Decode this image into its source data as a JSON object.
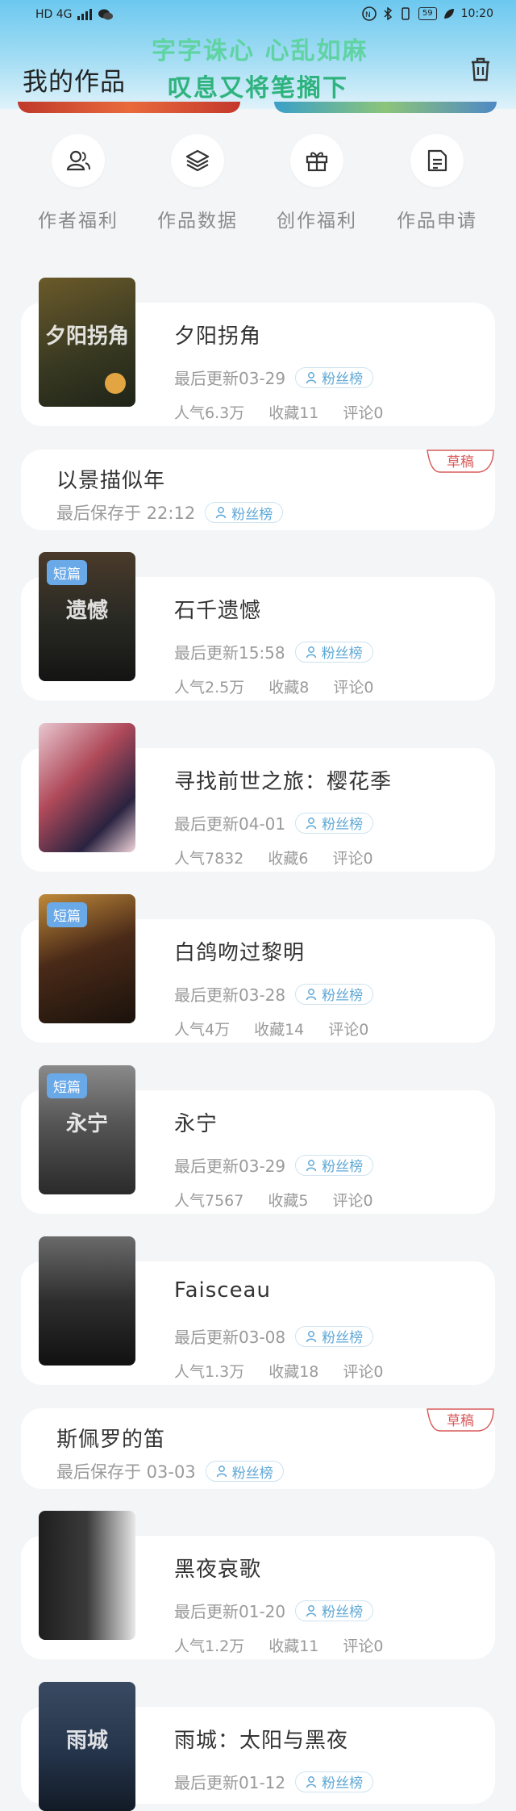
{
  "status_bar": {
    "network": "HD 4G",
    "battery": "59",
    "time": "10:20"
  },
  "header": {
    "title": "我的作品",
    "banner_line1": "字字诛心 心乱如麻",
    "banner_line2": "叹息又将笔搁下",
    "trash_icon": "trash-icon"
  },
  "quick_actions": [
    {
      "label": "作者福利",
      "icon": "user-group-icon"
    },
    {
      "label": "作品数据",
      "icon": "layers-icon"
    },
    {
      "label": "创作福利",
      "icon": "gift-icon"
    },
    {
      "label": "作品申请",
      "icon": "document-icon"
    }
  ],
  "works": [
    {
      "title": "夕阳拐角",
      "updated": "最后更新03-29",
      "badge": "粉丝榜",
      "popularity": "人气6.3万",
      "favorites": "收藏11",
      "comments": "评论0",
      "cover_color": "#3a3a22",
      "cover_text": "夕阳拐角",
      "tag": ""
    },
    {
      "title": "石千遗憾",
      "updated": "最后更新15:58",
      "badge": "粉丝榜",
      "popularity": "人气2.5万",
      "favorites": "收藏8",
      "comments": "评论0",
      "cover_color": "#2a2a24",
      "cover_text": "遗憾",
      "tag": "短篇"
    },
    {
      "title": "寻找前世之旅：樱花季",
      "updated": "最后更新04-01",
      "badge": "粉丝榜",
      "popularity": "人气7832",
      "favorites": "收藏6",
      "comments": "评论0",
      "cover_color": "#b04a5a",
      "cover_text": "",
      "tag": ""
    },
    {
      "title": "白鸽吻过黎明",
      "updated": "最后更新03-28",
      "badge": "粉丝榜",
      "popularity": "人气4万",
      "favorites": "收藏14",
      "comments": "评论0",
      "cover_color": "#4a2a18",
      "cover_text": "",
      "tag": "短篇"
    },
    {
      "title": "永宁",
      "updated": "最后更新03-29",
      "badge": "粉丝榜",
      "popularity": "人气7567",
      "favorites": "收藏5",
      "comments": "评论0",
      "cover_color": "#555555",
      "cover_text": "永宁",
      "tag": "短篇"
    },
    {
      "title": "Faisceau",
      "updated": "最后更新03-08",
      "badge": "粉丝榜",
      "popularity": "人气1.3万",
      "favorites": "收藏18",
      "comments": "评论0",
      "cover_color": "#2e2e2e",
      "cover_text": "",
      "tag": ""
    },
    {
      "title": "黑夜哀歌",
      "updated": "最后更新01-20",
      "badge": "粉丝榜",
      "popularity": "人气1.2万",
      "favorites": "收藏11",
      "comments": "评论0",
      "cover_color": "#1e1e1e",
      "cover_text": "",
      "tag": ""
    },
    {
      "title": "雨城：太阳与黑夜",
      "updated": "最后更新01-12",
      "badge": "粉丝榜",
      "popularity": "",
      "favorites": "",
      "comments": "",
      "cover_color": "#24344a",
      "cover_text": "雨城",
      "tag": ""
    }
  ],
  "drafts": [
    {
      "title": "以景描似年",
      "saved": "最后保存于 22:12",
      "badge": "粉丝榜",
      "label": "草稿"
    },
    {
      "title": "斯佩罗的笛",
      "saved": "最后保存于 03-03",
      "badge": "粉丝榜",
      "label": "草稿"
    }
  ]
}
